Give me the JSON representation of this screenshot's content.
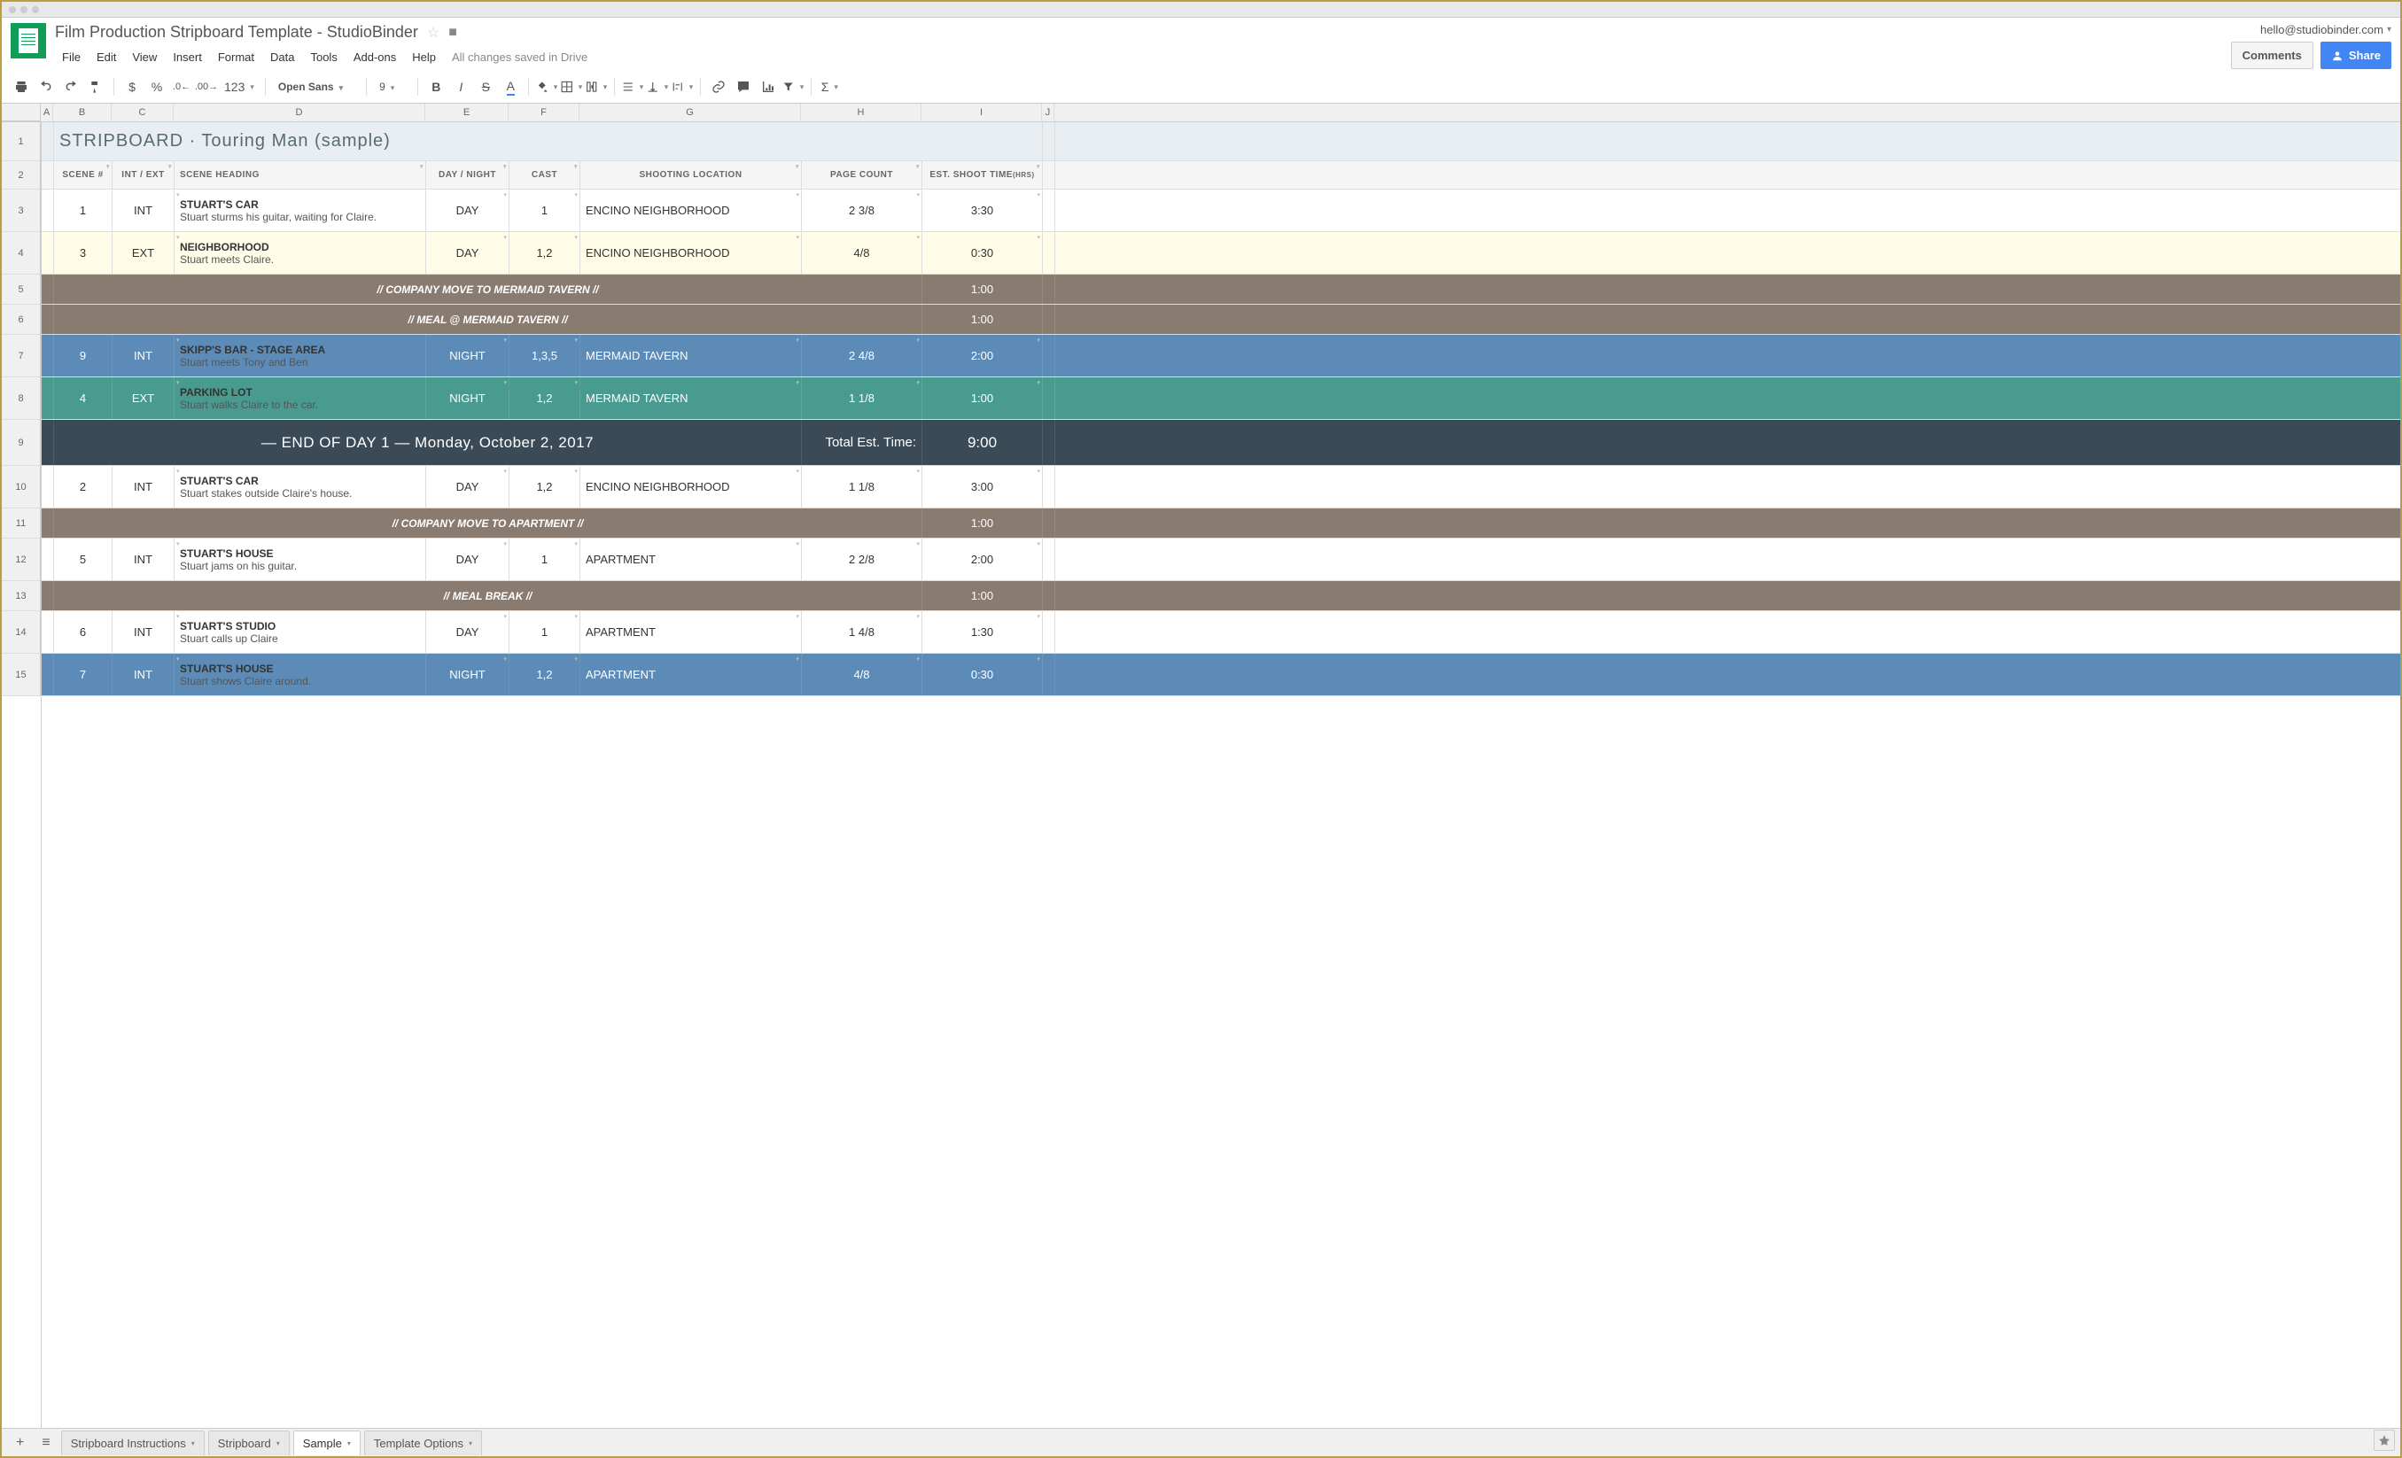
{
  "doc": {
    "title": "Film Production Stripboard Template  -  StudioBinder",
    "user_email": "hello@studiobinder.com",
    "saved_text": "All changes saved in Drive"
  },
  "menus": [
    "File",
    "Edit",
    "View",
    "Insert",
    "Format",
    "Data",
    "Tools",
    "Add-ons",
    "Help"
  ],
  "buttons": {
    "comments": "Comments",
    "share": "Share"
  },
  "toolbar": {
    "font": "Open Sans",
    "size": "9"
  },
  "columns": [
    "A",
    "B",
    "C",
    "D",
    "E",
    "F",
    "G",
    "H",
    "I",
    "J"
  ],
  "stripboard": {
    "title": "STRIPBOARD · Touring Man (sample)",
    "headers": {
      "scene": "SCENE #",
      "intext": "INT / EXT",
      "heading": "SCENE HEADING",
      "daynight": "DAY / NIGHT",
      "cast": "CAST",
      "location": "SHOOTING LOCATION",
      "pagecount": "PAGE COUNT",
      "shoottime": "EST. SHOOT TIME",
      "hrs": "(HRS)"
    }
  },
  "rows": [
    {
      "type": "scene",
      "bg": "white",
      "num": "1",
      "ie": "INT",
      "head": "STUART'S CAR",
      "desc": "Stuart sturms his guitar, waiting for Claire.",
      "dn": "DAY",
      "cast": "1",
      "loc": "ENCINO NEIGHBORHOOD",
      "pc": "2 3/8",
      "st": "3:30"
    },
    {
      "type": "scene",
      "bg": "yellow",
      "num": "3",
      "ie": "EXT",
      "head": "NEIGHBORHOOD",
      "desc": "Stuart meets Claire.",
      "dn": "DAY",
      "cast": "1,2",
      "loc": "ENCINO NEIGHBORHOOD",
      "pc": "4/8",
      "st": "0:30"
    },
    {
      "type": "banner",
      "bg": "brown",
      "text": "// COMPANY MOVE TO MERMAID TAVERN //",
      "st": "1:00"
    },
    {
      "type": "banner",
      "bg": "brown",
      "text": "// MEAL @ MERMAID TAVERN //",
      "st": "1:00"
    },
    {
      "type": "scene",
      "bg": "blue",
      "num": "9",
      "ie": "INT",
      "head": "SKIPP'S BAR - STAGE AREA",
      "desc": "Stuart meets Tony and Ben",
      "dn": "NIGHT",
      "cast": "1,3,5",
      "loc": "MERMAID TAVERN",
      "pc": "2 4/8",
      "st": "2:00"
    },
    {
      "type": "scene",
      "bg": "teal",
      "num": "4",
      "ie": "EXT",
      "head": "PARKING LOT",
      "desc": "Stuart walks Claire to the car.",
      "dn": "NIGHT",
      "cast": "1,2",
      "loc": "MERMAID TAVERN",
      "pc": "1 1/8",
      "st": "1:00"
    },
    {
      "type": "endday",
      "bg": "navy",
      "text": "— END OF DAY 1 —  Monday, October 2, 2017",
      "total_label": "Total Est. Time:",
      "total": "9:00"
    },
    {
      "type": "scene",
      "bg": "white",
      "num": "2",
      "ie": "INT",
      "head": "STUART'S CAR",
      "desc": "Stuart stakes outside Claire's house.",
      "dn": "DAY",
      "cast": "1,2",
      "loc": "ENCINO NEIGHBORHOOD",
      "pc": "1 1/8",
      "st": "3:00"
    },
    {
      "type": "banner",
      "bg": "brown",
      "text": "// COMPANY MOVE TO APARTMENT //",
      "st": "1:00"
    },
    {
      "type": "scene",
      "bg": "white",
      "num": "5",
      "ie": "INT",
      "head": "STUART'S HOUSE",
      "desc": "Stuart jams on his guitar.",
      "dn": "DAY",
      "cast": "1",
      "loc": "APARTMENT",
      "pc": "2 2/8",
      "st": "2:00"
    },
    {
      "type": "banner",
      "bg": "brown",
      "text": "// MEAL BREAK //",
      "st": "1:00"
    },
    {
      "type": "scene",
      "bg": "white",
      "num": "6",
      "ie": "INT",
      "head": "STUART'S STUDIO",
      "desc": "Stuart calls up Claire",
      "dn": "DAY",
      "cast": "1",
      "loc": "APARTMENT",
      "pc": "1 4/8",
      "st": "1:30"
    },
    {
      "type": "scene",
      "bg": "blue",
      "num": "7",
      "ie": "INT",
      "head": "STUART'S HOUSE",
      "desc": "Stuart shows Claire around.",
      "dn": "NIGHT",
      "cast": "1,2",
      "loc": "APARTMENT",
      "pc": "4/8",
      "st": "0:30"
    }
  ],
  "tabs": [
    "Stripboard Instructions",
    "Stripboard",
    "Sample",
    "Template Options"
  ],
  "active_tab": 2
}
